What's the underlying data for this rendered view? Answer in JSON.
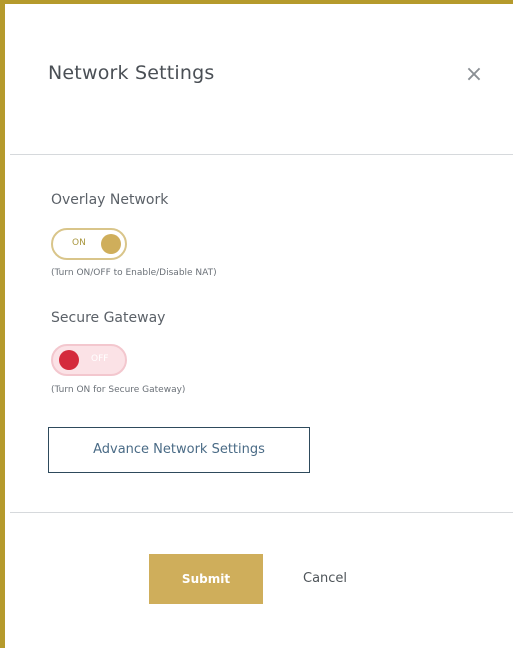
{
  "dialog": {
    "title": "Network Settings",
    "close_symbol": "×"
  },
  "overlay_network": {
    "label": "Overlay Network",
    "toggle_text": "ON",
    "state": "on",
    "hint": "(Turn ON/OFF to Enable/Disable NAT)"
  },
  "secure_gateway": {
    "label": "Secure Gateway",
    "toggle_text": "OFF",
    "state": "off",
    "hint": "(Turn ON for Secure Gateway)"
  },
  "advance_button": {
    "label": "Advance Network Settings"
  },
  "footer": {
    "submit_label": "Submit",
    "cancel_label": "Cancel"
  },
  "colors": {
    "accent_gold": "#cfae5b",
    "frame_gold": "#b59a2c",
    "toggle_off_red": "#d42a3c",
    "button_border": "#2e4a5c"
  },
  "icons": {
    "close": "close-icon",
    "toggle_knob": "toggle-knob"
  }
}
